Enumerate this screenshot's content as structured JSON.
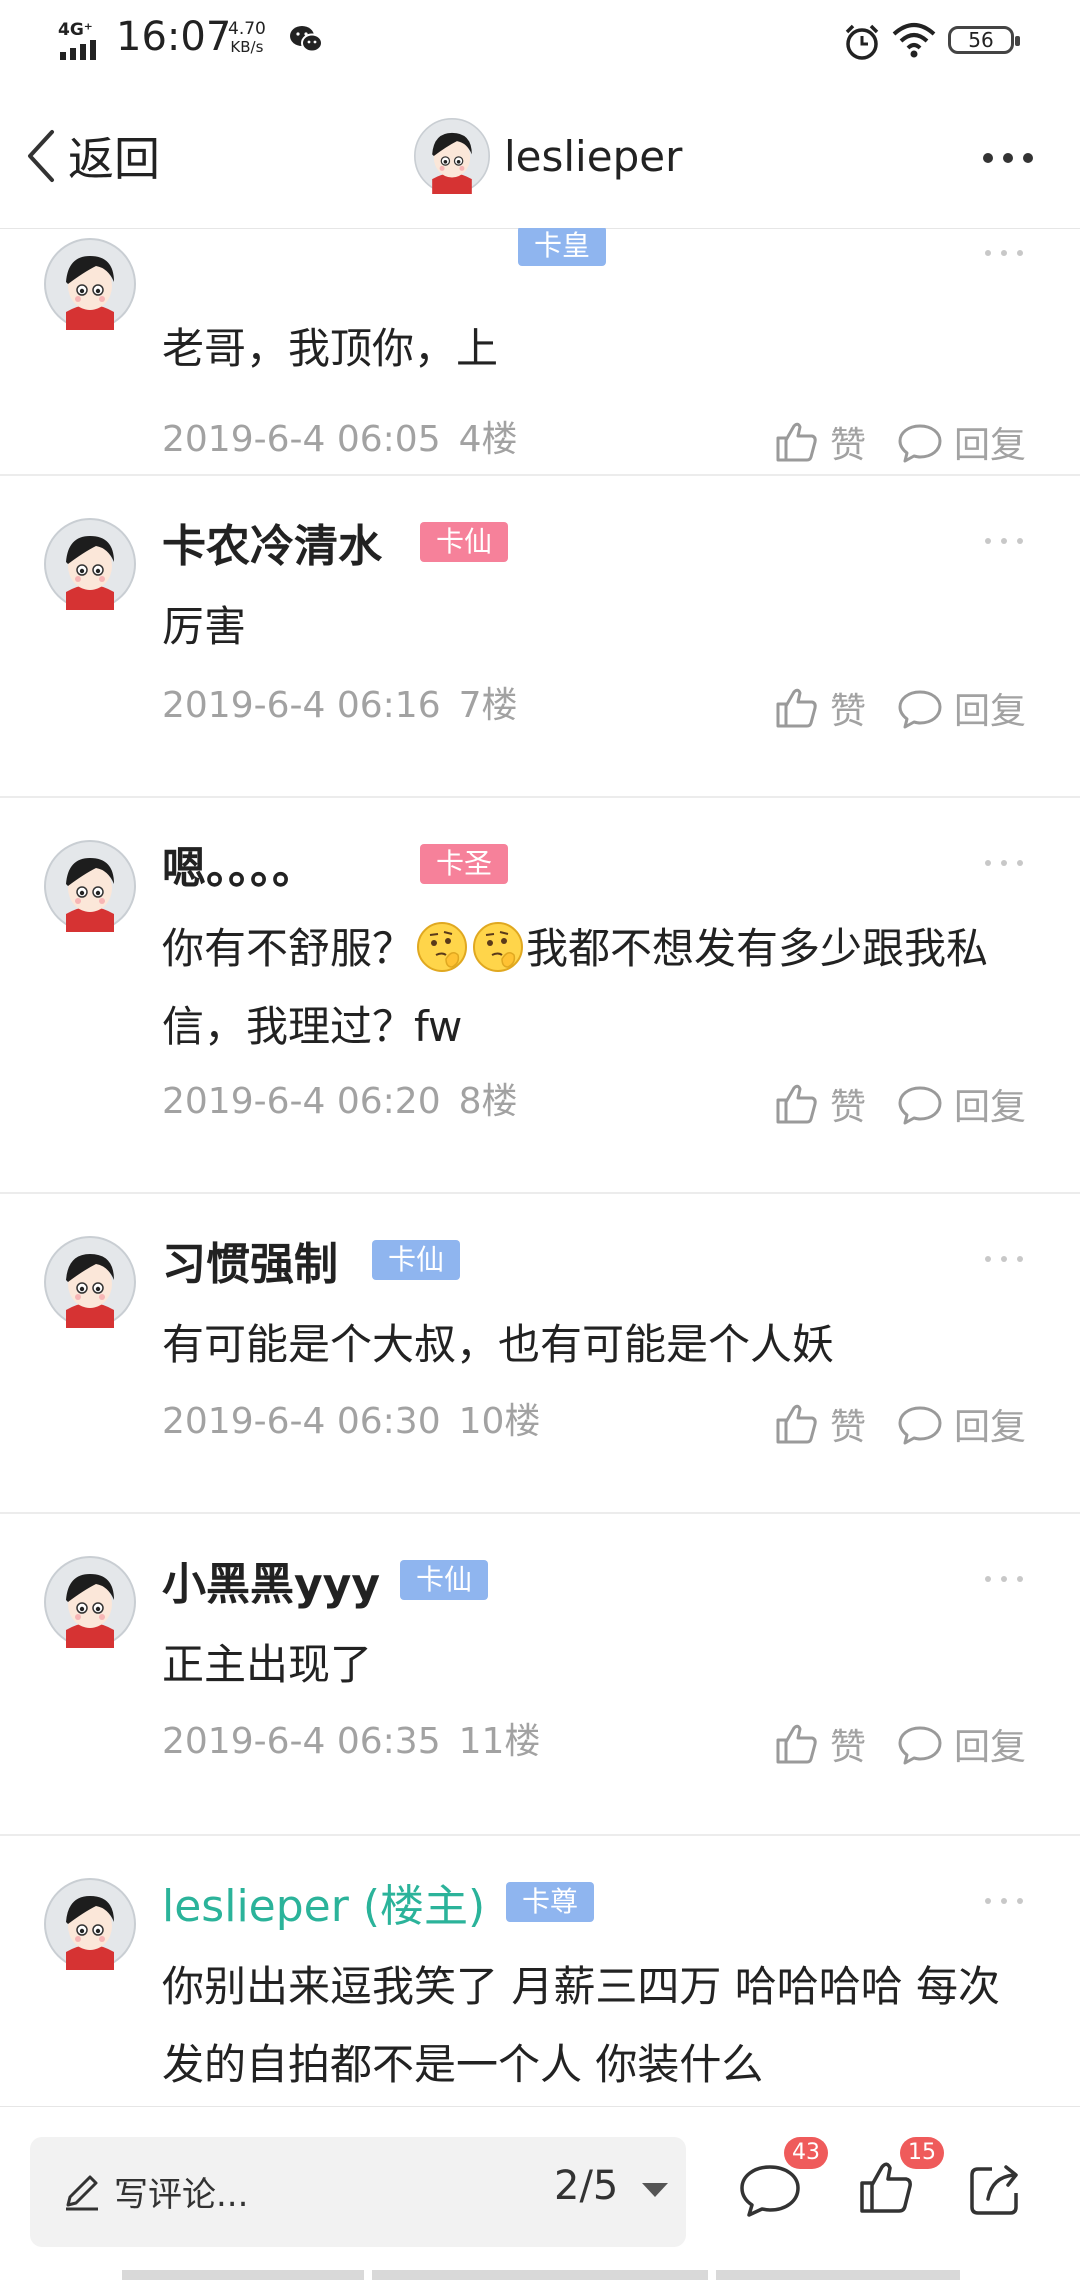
{
  "status_bar": {
    "network": "4G⁺",
    "time": "16:07",
    "speed_value": "4.70",
    "speed_unit": "KB/s",
    "battery": "56"
  },
  "nav": {
    "back_label": "返回",
    "title": "leslieper"
  },
  "comments": [
    {
      "username": "",
      "badge": "卡皇",
      "content": "老哥，我顶你，上",
      "time": "2019-6-4 06:05",
      "floor": "4楼",
      "like": "赞",
      "reply": "回复"
    },
    {
      "username": "卡农冷清水",
      "badge": "卡仙",
      "content": "厉害",
      "time": "2019-6-4 06:16",
      "floor": "7楼",
      "like": "赞",
      "reply": "回复"
    },
    {
      "username": "嗯。。。。",
      "badge": "卡圣",
      "content_before": "你有不舒服？",
      "content_after": "我都不想发有多少跟我私信，我理过？fw",
      "time": "2019-6-4 06:20",
      "floor": "8楼",
      "like": "赞",
      "reply": "回复"
    },
    {
      "username": "习惯强制",
      "badge": "卡仙",
      "content": "有可能是个大叔，也有可能是个人妖",
      "time": "2019-6-4 06:30",
      "floor": "10楼",
      "like": "赞",
      "reply": "回复"
    },
    {
      "username": "小黑黑yyy",
      "badge": "卡仙",
      "content": "正主出现了",
      "time": "2019-6-4 06:35",
      "floor": "11楼",
      "like": "赞",
      "reply": "回复"
    },
    {
      "username": "leslieper (楼主)",
      "badge": "卡尊",
      "content": "你别出来逗我笑了 月薪三四万 哈哈哈哈 每次发的自拍都不是一个人  你装什么"
    }
  ],
  "bottom": {
    "placeholder": "写评论...",
    "page_indicator": "2/5",
    "comment_count": "43",
    "like_count": "15"
  },
  "colors": {
    "badge_blue": "#8fb5ef",
    "badge_pink": "#f6819a",
    "owner_green": "#2bb39a",
    "count_badge_red": "#ef5b5b"
  },
  "icons": [
    "signal-icon",
    "wechat-icon",
    "alarm-icon",
    "wifi-icon",
    "battery-icon",
    "back-chevron-icon",
    "more-dots-icon",
    "avatar",
    "thumbs-up-icon",
    "reply-bubble-icon",
    "thinking-emoji-icon",
    "pencil-icon",
    "caret-down-icon",
    "comment-icon",
    "share-icon"
  ]
}
